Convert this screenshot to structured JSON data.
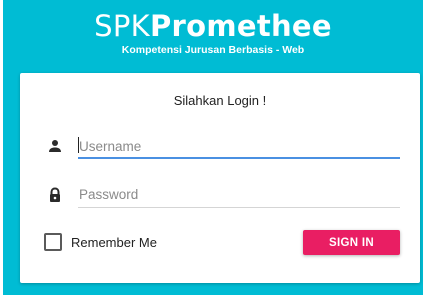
{
  "brand": {
    "title_light": "SPK",
    "title_bold": "Promethee",
    "subtitle": "Kompetensi Jurusan Berbasis - Web"
  },
  "form": {
    "heading": "Silahkan Login !",
    "username_placeholder": "Username",
    "password_placeholder": "Password",
    "remember_label": "Remember Me",
    "remember_checked": false,
    "submit_label": "SIGN IN"
  },
  "icons": {
    "username": "person-icon",
    "password": "lock-icon"
  },
  "colors": {
    "background": "#00bcd4",
    "button": "#e91e63",
    "active_underline": "#4a90e2"
  }
}
